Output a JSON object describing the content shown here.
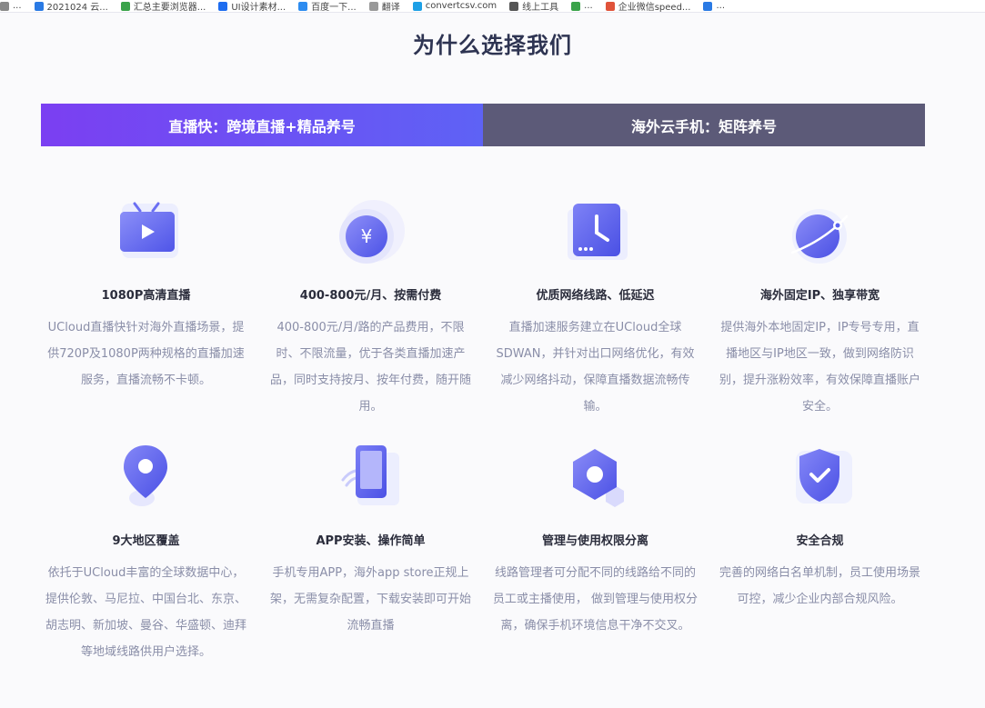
{
  "bookmarks": [
    {
      "label": "...",
      "color": "#888888"
    },
    {
      "label": "2021024 云...",
      "color": "#2a7ae4"
    },
    {
      "label": "汇总主要浏览器...",
      "color": "#3aa34a"
    },
    {
      "label": "UI设计素材...",
      "color": "#1e6df0"
    },
    {
      "label": "百度一下...",
      "color": "#2d8cf0"
    },
    {
      "label": "翻译",
      "color": "#999999"
    },
    {
      "label": "convertcsv.com",
      "color": "#1ea0e6"
    },
    {
      "label": "线上工具",
      "color": "#555555"
    },
    {
      "label": "...",
      "color": "#3aa34a"
    },
    {
      "label": "企业微信speed...",
      "color": "#e0533a"
    },
    {
      "label": "...",
      "color": "#2a7ae4"
    }
  ],
  "section": {
    "title": "为什么选择我们"
  },
  "tabs": [
    {
      "label": "直播快：跨境直播+精品养号",
      "active": true
    },
    {
      "label": "海外云手机：矩阵养号",
      "active": false
    }
  ],
  "features": [
    {
      "icon": "live-tv-icon",
      "title": "1080P高清直播",
      "desc": "UCloud直播快针对海外直播场景，提供720P及1080P两种规格的直播加速服务，直播流畅不卡顿。"
    },
    {
      "icon": "yuan-coin-icon",
      "title": "400-800元/月、按需付费",
      "desc": "400-800元/月/路的产品费用，不限时、不限流量，优于各类直播加速产品，同时支持按月、按年付费，随开随用。"
    },
    {
      "icon": "clock-icon",
      "title": "优质网络线路、低延迟",
      "desc": "直播加速服务建立在UCloud全球SDWAN，并针对出口网络优化，有效减少网络抖动，保障直播数据流畅传输。"
    },
    {
      "icon": "globe-orbit-icon",
      "title": "海外固定IP、独享带宽",
      "desc": "提供海外本地固定IP，IP专号专用，直播地区与IP地区一致，做到网络防识别，提升涨粉效率，有效保障直播账户安全。"
    },
    {
      "icon": "location-pin-icon",
      "title": "9大地区覆盖",
      "desc": "依托于UCloud丰富的全球数据中心，提供伦敦、马尼拉、中国台北、东京、胡志明、新加坡、曼谷、华盛顿、迪拜等地域线路供用户选择。"
    },
    {
      "icon": "mobile-phone-icon",
      "title": "APP安装、操作简单",
      "desc": "手机专用APP，海外app store正规上架，无需复杂配置，下载安装即可开始流畅直播"
    },
    {
      "icon": "hexagon-permission-icon",
      "title": "管理与使用权限分离",
      "desc": "线路管理者可分配不同的线路给不同的员工或主播使用， 做到管理与使用权分离，确保手机环境信息干净不交叉。"
    },
    {
      "icon": "shield-check-icon",
      "title": "安全合规",
      "desc": "完善的网络白名单机制，员工使用场景可控，减少企业内部合规风险。"
    }
  ],
  "colors": {
    "accent_start": "#7b3ff2",
    "accent_end": "#5e62f5",
    "tab_inactive": "#5c5a78",
    "icon_primary": "#5b62f0",
    "desc_text": "#8a8ea8"
  }
}
